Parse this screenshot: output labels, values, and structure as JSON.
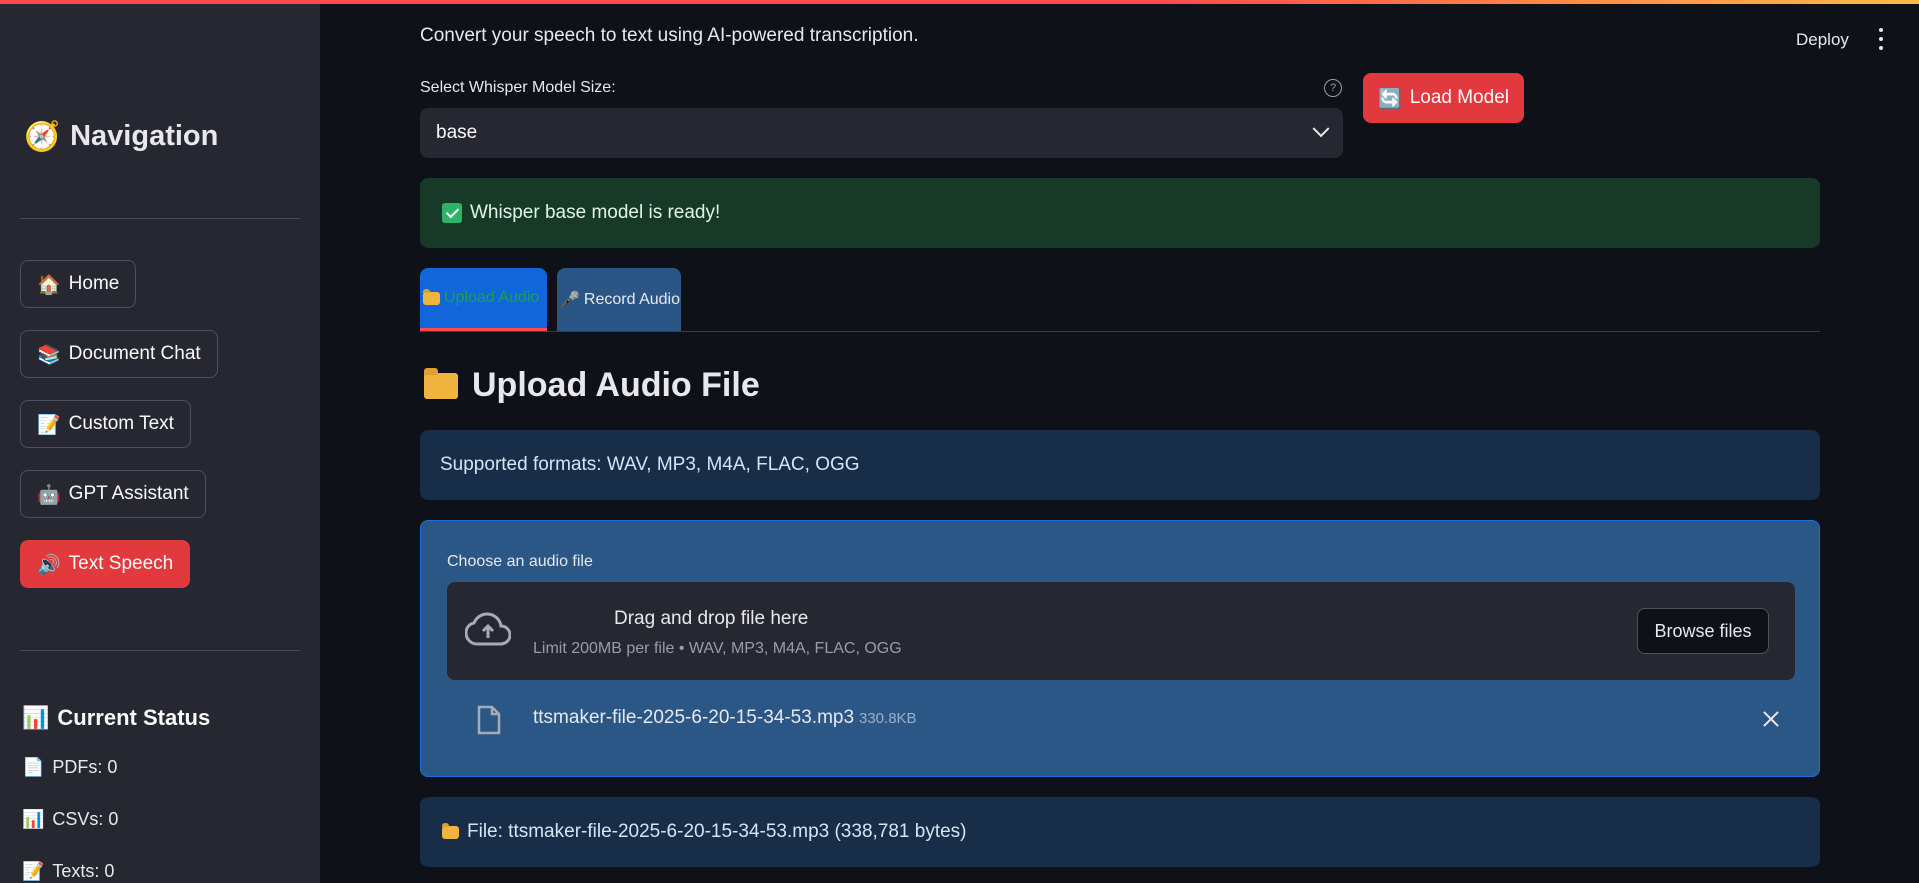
{
  "sidebar": {
    "title_icon": "compass-icon",
    "title": "Navigation",
    "nav": [
      {
        "icon": "house-icon",
        "emoji": "🏠",
        "label": "Home"
      },
      {
        "icon": "books-icon",
        "emoji": "📚",
        "label": "Document Chat"
      },
      {
        "icon": "memo-icon",
        "emoji": "📝",
        "label": "Custom Text"
      },
      {
        "icon": "robot-icon",
        "emoji": "🤖",
        "label": "GPT Assistant"
      },
      {
        "icon": "speaker-icon",
        "emoji": "🔊",
        "label": "Text Speech"
      }
    ],
    "status_title": "Current Status",
    "status": [
      {
        "icon": "document-icon",
        "emoji": "📄",
        "label": "PDFs: 0"
      },
      {
        "icon": "chart-icon",
        "emoji": "📊",
        "label": "CSVs: 0"
      },
      {
        "icon": "memo-icon",
        "emoji": "📝",
        "label": "Texts: 0"
      }
    ]
  },
  "header": {
    "subtitle": "Convert your speech to text using AI-powered transcription.",
    "deploy_label": "Deploy"
  },
  "model": {
    "select_label": "Select Whisper Model Size:",
    "selected": "base",
    "load_label": "Load Model",
    "load_emoji": "🔄"
  },
  "alert": {
    "text": "Whisper base model is ready!"
  },
  "tabs": [
    {
      "emoji": "📁",
      "label": "Upload Audio",
      "active": true
    },
    {
      "emoji": "🎤",
      "label": "Record Audio",
      "active": false
    }
  ],
  "upload": {
    "heading": "Upload Audio File",
    "supported": "Supported formats: WAV, MP3, M4A, FLAC, OGG",
    "choose_label": "Choose an audio file",
    "drop_title": "Drag and drop file here",
    "limit": "Limit 200MB per file • WAV, MP3, M4A, FLAC, OGG",
    "browse_label": "Browse files",
    "file_name": "ttsmaker-file-2025-6-20-15-34-53.mp3",
    "file_size": "330.8KB",
    "file_info": "File: ttsmaker-file-2025-6-20-15-34-53.mp3 (338,781 bytes)"
  },
  "colors": {
    "accent": "#e2393f",
    "success_bg": "#173928",
    "info_bg": "#172d48",
    "tab_active": "#1167d9"
  }
}
